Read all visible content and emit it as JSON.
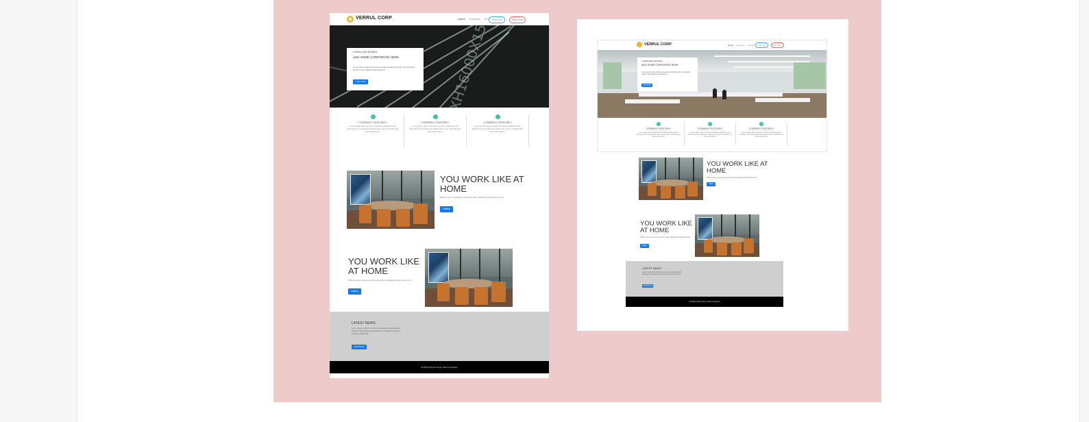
{
  "colors": {
    "canvas_bg": "#eecaca",
    "accent_blue": "#1679ea",
    "feature_green": "#41c694",
    "logo_yellow": "#f1b634",
    "buy_red": "#e86262",
    "news_gray": "#cfcfcf",
    "footer_black": "#000000"
  },
  "mockup_a": {
    "brand": "VERRUL CORP",
    "nav": {
      "home": "Home",
      "features": "Features",
      "pricing": "Pricing",
      "signup": "Sign Up",
      "buy": "Buy Now"
    },
    "hero": {
      "small_header": "A SMALLER HEADER",
      "corporate": "ADD SOME CORPORATE HERE",
      "body": "Lorem ipsum dolor sit amet consectetur adipiscing elit. Accusantium nostrum iusto debitis nobis laborum.",
      "button": "A BUTTON",
      "image_text": "XH16000X150"
    },
    "features": [
      {
        "title": "COMPANY FEATURE I",
        "desc": "Lorem ipsum dolor sit amet consectetur adipisicing elit. Excepturi sunt repellendus debitis quia neque molestiae sed dicta natus ipsum."
      },
      {
        "title": "COMPANY FEATURE I",
        "desc": "Lorem ipsum dolor sit amet consectetur adipisicing elit. Excepturi sunt repellendus debitis quia neque molestiae sed dicta natus ipsum."
      },
      {
        "title": "COMPANY FEATURE I",
        "desc": "Lorem ipsum dolor sit amet consectetur adipisicing elit. Excepturi sunt repellendus debitis quia neque molestiae sed dicta natus ipsum."
      }
    ],
    "work1": {
      "title": "YOU WORK LIKE AT HOME",
      "desc": "Nihilo tempor consectetur sint velit nulla cupidatat sint laboriosam non.",
      "button": "Gallery"
    },
    "work2": {
      "title": "YOU WORK LIKE AT HOME",
      "desc": "Nihilo tempor consectetur sint velit nulla cupidatat sint laboriosam non.",
      "button": "Gallery"
    },
    "news": {
      "title": "LATEST NEWS",
      "body": "Lorem ipsum dolor sit amet consectetur adipiscing elit. Placeat nisi beatae praesentium accusamus nostrum voluptas officia ad.",
      "button": "OUR BLOG"
    },
    "footer": "All Rights Reserved by Delos Dynamics"
  },
  "mockup_b": {
    "brand": "VERRUL CORP",
    "nav": {
      "home": "Home",
      "features": "Features",
      "pricing": "Pricing",
      "signup": "Sign Up",
      "buy": "Buy Now"
    },
    "hero": {
      "small_header": "A SMALLER HEADER",
      "corporate": "ADD SOME CORPORATE HERE",
      "body": "Lorem ipsum dolor sit amet consectetur adipiscing elit. Accusantium nostrum iusto debitis nobis laborum.",
      "button": "A BUTTON"
    },
    "features": [
      {
        "title": "COMPANY FEATURE I",
        "desc": "Lorem ipsum dolor sit amet consectetur adipisicing elit. Excepturi sunt repellendus debitis quia neque molestiae sed dicta natus ipsum."
      },
      {
        "title": "COMPANY FEATURE I",
        "desc": "Lorem ipsum dolor sit amet consectetur adipisicing elit. Excepturi sunt repellendus debitis quia neque molestiae sed dicta natus ipsum."
      },
      {
        "title": "COMPANY FEATURE I",
        "desc": "Lorem ipsum dolor sit amet consectetur adipisicing elit. Excepturi sunt repellendus debitis quia neque molestiae sed dicta natus ipsum."
      }
    ],
    "work1": {
      "title": "YOU WORK LIKE AT HOME",
      "desc": "Nihilo tempor consectetur sint velit nulla cupidatat sint laboriosam non.",
      "button": "Gallery"
    },
    "work2": {
      "title": "YOU WORK LIKE AT HOME",
      "desc": "Nihilo tempor consectetur sint velit nulla cupidatat sint laboriosam non.",
      "button": "Gallery"
    },
    "news": {
      "title": "LATEST NEWS",
      "body": "Lorem ipsum dolor sit amet consectetur adipiscing elit. Placeat nisi beatae praesentium accusamus nostrum.",
      "button": "OUR BLOG"
    },
    "footer": "All Rights Reserved by Delos Dynamics"
  }
}
